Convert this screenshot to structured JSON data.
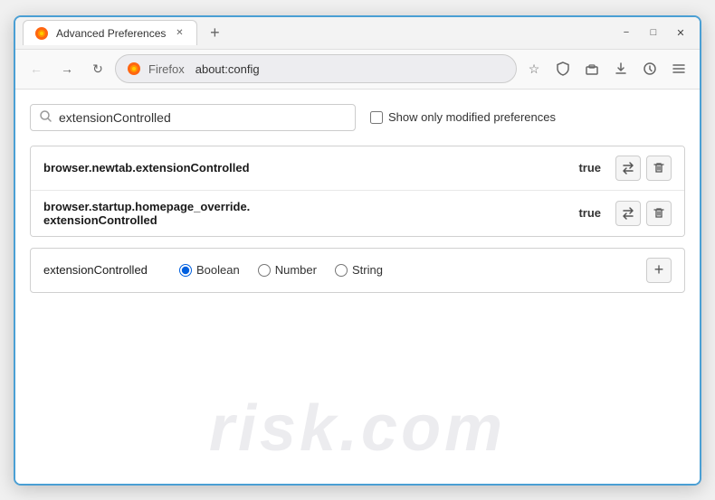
{
  "window": {
    "title": "Advanced Preferences",
    "tab_label": "Advanced Preferences",
    "new_tab_icon": "+",
    "minimize_label": "−",
    "maximize_label": "□",
    "close_label": "✕"
  },
  "navbar": {
    "back_label": "←",
    "forward_label": "→",
    "reload_label": "↺",
    "firefox_label": "Firefox",
    "address": "about:config",
    "bookmark_icon": "☆",
    "shield_icon": "🛡",
    "extension_icon": "🧩",
    "download_icon": "⬇",
    "history_icon": "↺",
    "menu_icon": "≡"
  },
  "search": {
    "placeholder": "extensionControlled",
    "value": "extensionControlled",
    "checkbox_label": "Show only modified preferences"
  },
  "results": [
    {
      "name": "browser.newtab.extensionControlled",
      "value": "true"
    },
    {
      "name": "browser.startup.homepage_override.\nextensionControlled",
      "name_line1": "browser.startup.homepage_override.",
      "name_line2": "extensionControlled",
      "value": "true"
    }
  ],
  "add_pref": {
    "name": "extensionControlled",
    "types": [
      {
        "id": "boolean",
        "label": "Boolean",
        "checked": true
      },
      {
        "id": "number",
        "label": "Number",
        "checked": false
      },
      {
        "id": "string",
        "label": "String",
        "checked": false
      }
    ],
    "add_btn_label": "+"
  },
  "watermark": {
    "text": "risk.com"
  },
  "icons": {
    "search": "🔍",
    "swap": "⇌",
    "delete": "🗑"
  }
}
